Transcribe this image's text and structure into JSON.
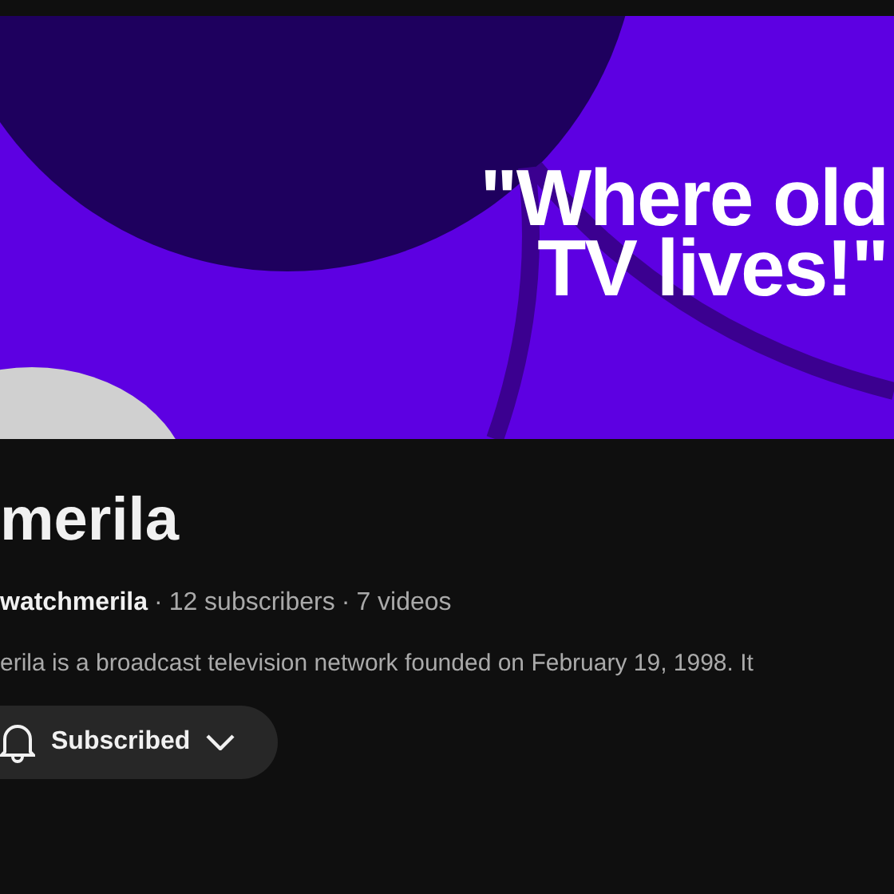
{
  "banner": {
    "kind": "picture",
    "slogan_lines": [
      "\"Where old",
      "TV lives!\""
    ]
  },
  "channel": {
    "name": "merila",
    "handle": "watchmerila",
    "subscribers": "12 subscribers",
    "videos": "7 videos",
    "separator": "·",
    "description": "erila is a broadcast television network founded on February 19, 1998. It"
  },
  "subscribe_button": {
    "label": "Subscribed",
    "subscribed": true
  }
}
